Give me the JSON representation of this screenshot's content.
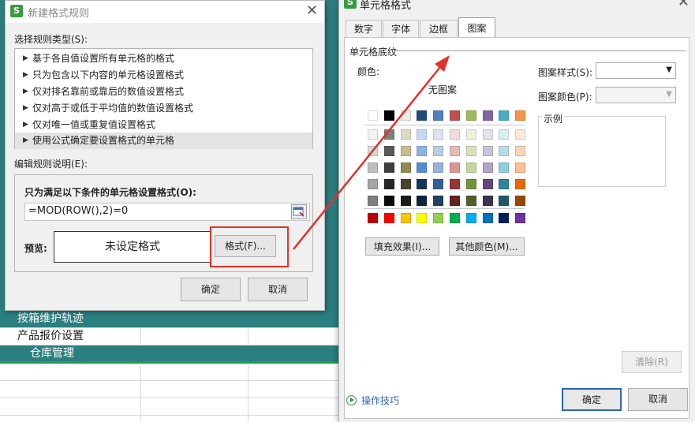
{
  "spreadsheet": {
    "rows": [
      "按箱维护轨迹",
      "产品报价设置",
      "仓库管理"
    ]
  },
  "new_rule_dialog": {
    "title": "新建格式规则",
    "app_icon": "S",
    "close_glyph": "✕",
    "select_type_label": "选择规则类型(S):",
    "rule_types": [
      "基于各自值设置所有单元格的格式",
      "只为包含以下内容的单元格设置格式",
      "仅对排名靠前或靠后的数值设置格式",
      "仅对高于或低于平均值的数值设置格式",
      "仅对唯一值或重复值设置格式",
      "使用公式确定要设置格式的单元格"
    ],
    "selected_rule_index": 5,
    "edit_desc_label": "编辑规则说明(E):",
    "formula_label": "只为满足以下条件的单元格设置格式(O):",
    "formula_value": "=MOD(ROW(),2)=0",
    "preview_label": "预览:",
    "preview_text": "未设定格式",
    "format_button": "格式(F)...",
    "ok_button": "确定",
    "cancel_button": "取消"
  },
  "format_cells_dialog": {
    "title": "单元格格式",
    "app_icon": "S",
    "close_glyph": "✕",
    "tabs": [
      "数字",
      "字体",
      "边框",
      "图案"
    ],
    "active_tab": "图案",
    "section_title": "单元格底纹",
    "color_label": "颜色:",
    "no_pattern": "无图案",
    "pattern_style_label": "图案样式(S):",
    "pattern_color_label": "图案颜色(P):",
    "sample_label": "示例",
    "fill_effects_button": "填充效果(I)...",
    "more_colors_button": "其他颜色(M)...",
    "clear_button": "清除(R)",
    "tips_link": "操作技巧",
    "ok_button": "确定",
    "cancel_button": "取消",
    "theme_colors": [
      [
        "#ffffff",
        "#000000",
        "#eeece1",
        "#1f497d",
        "#4f81bd",
        "#c0504d",
        "#9bbb59",
        "#8064a2",
        "#4bacc6",
        "#f79646"
      ],
      [
        "#f2f2f2",
        "#7f7f7f",
        "#ddd9c3",
        "#c6d9f0",
        "#dbe5f1",
        "#f2dcdb",
        "#ebf1dd",
        "#e5e0ec",
        "#dbeef3",
        "#fdeada"
      ],
      [
        "#d8d8d8",
        "#595959",
        "#c4bd97",
        "#8db3e2",
        "#b8cce4",
        "#e5b9b7",
        "#d7e3bc",
        "#ccc1d9",
        "#b7dde8",
        "#fbd5b5"
      ],
      [
        "#bfbfbf",
        "#3f3f3f",
        "#938953",
        "#548dd4",
        "#95b3d7",
        "#d99694",
        "#c3d69b",
        "#b2a2c7",
        "#92cddc",
        "#fac08f"
      ],
      [
        "#a5a5a5",
        "#262626",
        "#494429",
        "#17365d",
        "#366092",
        "#953734",
        "#76923c",
        "#5f497a",
        "#31859b",
        "#e36c09"
      ],
      [
        "#7f7f7f",
        "#0c0c0c",
        "#1d1b10",
        "#0f243e",
        "#244061",
        "#632423",
        "#4f6128",
        "#3f3151",
        "#205867",
        "#974806"
      ]
    ],
    "standard_colors": [
      "#c00000",
      "#ff0000",
      "#ffc000",
      "#ffff00",
      "#92d050",
      "#00b050",
      "#00b0f0",
      "#0070c0",
      "#002060",
      "#7030a0"
    ]
  }
}
